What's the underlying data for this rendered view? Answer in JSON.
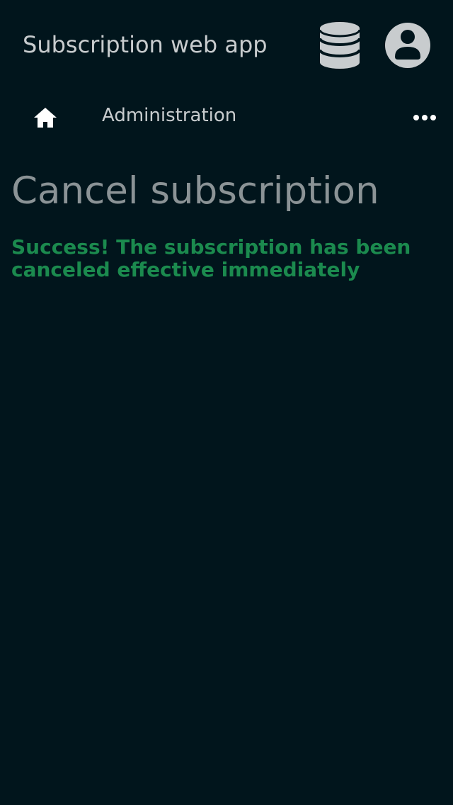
{
  "header": {
    "app_title": "Subscription web app",
    "database_icon": "database-icon",
    "account_icon": "account-circle-icon"
  },
  "nav": {
    "home_icon": "home-icon",
    "administration_label": "Administration",
    "more_icon": "more-horizontal-icon"
  },
  "main": {
    "page_title": "Cancel subscription",
    "success_message": "Success! The subscription has been canceled effective immediately"
  },
  "colors": {
    "background": "#01151c",
    "header_text": "#c8ccce",
    "title_text": "#8b9396",
    "success": "#1b8a4e",
    "icon": "#c8ccce",
    "nav_icon": "#ffffff"
  }
}
